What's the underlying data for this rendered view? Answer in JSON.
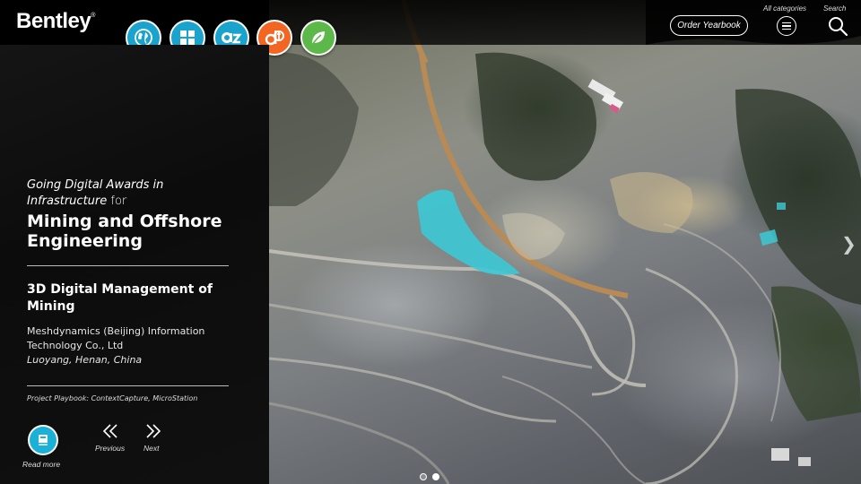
{
  "brand": {
    "logo_text": "Bentley",
    "logo_mark": "®"
  },
  "header": {
    "category_buttons": [
      {
        "icon": "globe-icon",
        "color": "#1aa3cc"
      },
      {
        "icon": "grid-icon",
        "color": "#1aa3cc"
      },
      {
        "icon": "az-index-icon",
        "color": "#1aa3cc"
      },
      {
        "icon": "digital-twin-icon",
        "color": "#f26522"
      },
      {
        "icon": "leaf-icon",
        "color": "#5cb849"
      }
    ],
    "order_label": "Order Yearbook",
    "all_categories_label": "All categories",
    "search_label": "Search"
  },
  "panel": {
    "award_intro_italic": "Going Digital Awards in Infrastructure",
    "award_intro_suffix": " for",
    "category": "Mining and Offshore Engineering",
    "project_title": "3D Digital Management of Mining",
    "organization": "Meshdynamics (Beijing) Information Technology Co., Ltd",
    "location": "Luoyang, Henan, China",
    "playbook": "Project Playbook: ContextCapture, MicroStation",
    "read_more_label": "Read more",
    "previous_label": "Previous",
    "next_label": "Next"
  },
  "carousel": {
    "total": 2,
    "current": 2
  },
  "colors": {
    "accent": "#1aa3cc",
    "orange": "#f26522",
    "green": "#5cb849",
    "water": "#3cc9d6"
  }
}
